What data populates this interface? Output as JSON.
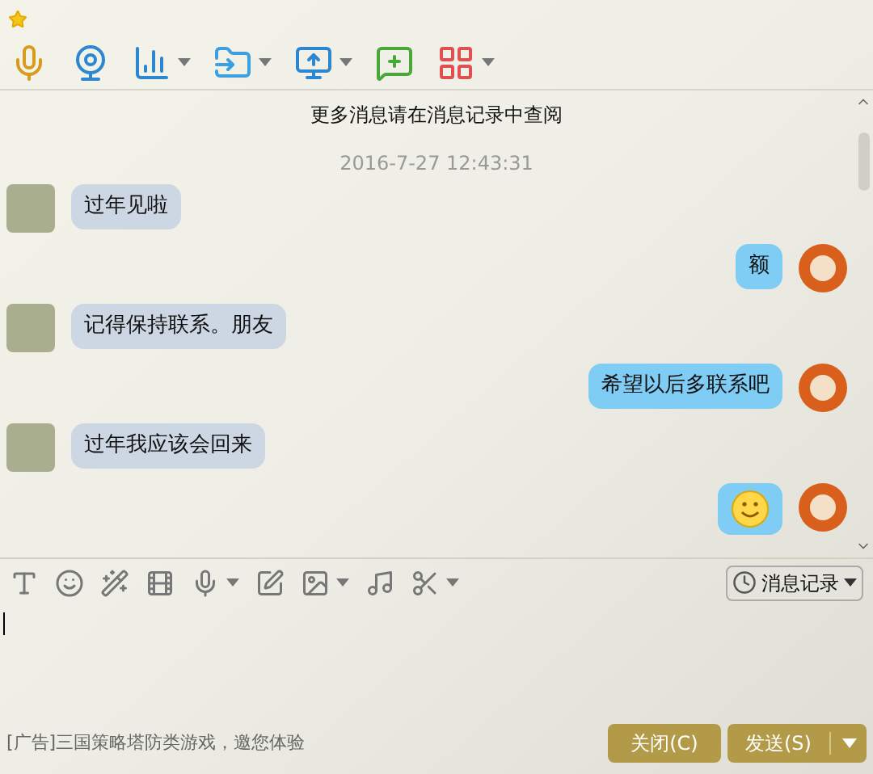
{
  "history_notice": "更多消息请在消息记录中查阅",
  "timestamp": "2016-7-27 12:43:31",
  "messages": [
    {
      "outgoing": false,
      "kind": "text",
      "text": "过年见啦"
    },
    {
      "outgoing": true,
      "kind": "text",
      "text": "额"
    },
    {
      "outgoing": false,
      "kind": "text",
      "text": "记得保持联系。朋友"
    },
    {
      "outgoing": true,
      "kind": "text",
      "text": "希望以后多联系吧"
    },
    {
      "outgoing": false,
      "kind": "text",
      "text": "过年我应该会回来"
    },
    {
      "outgoing": true,
      "kind": "emoji"
    }
  ],
  "history_button": "消息记录",
  "ad": "[广告]三国策略塔防类游戏，邀您体验",
  "close_button": "关闭(C)",
  "send_button": "发送(S)"
}
